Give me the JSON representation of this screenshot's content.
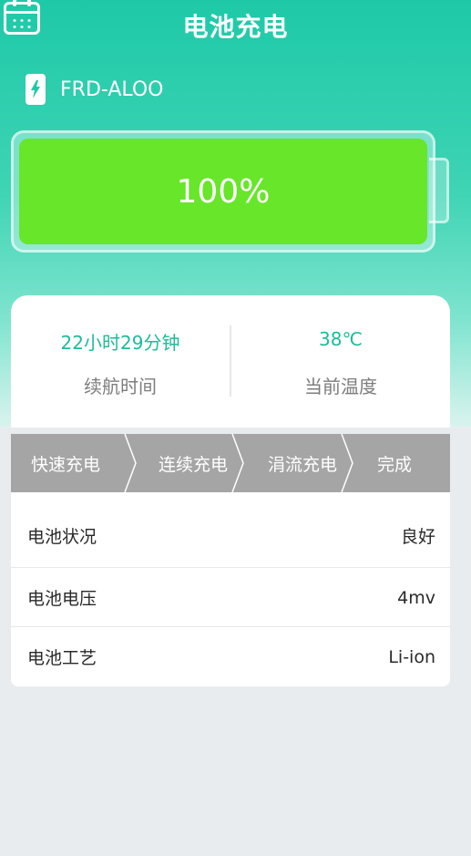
{
  "header": {
    "title": "电池充电"
  },
  "device": {
    "name": "FRD-ALOO"
  },
  "battery": {
    "level_percent": 100,
    "label": "100%",
    "fill_color": "#67e62a"
  },
  "stats": {
    "endurance": {
      "value": "22小时29分钟",
      "label": "续航时间"
    },
    "temperature": {
      "value": "38℃",
      "label": "当前温度"
    }
  },
  "charge_steps": [
    {
      "label": "快速充电"
    },
    {
      "label": "连续充电"
    },
    {
      "label": "涓流充电"
    },
    {
      "label": "完成"
    }
  ],
  "info": [
    {
      "label": "电池状况",
      "value": "良好"
    },
    {
      "label": "电池电压",
      "value": "4mv"
    },
    {
      "label": "电池工艺",
      "value": "Li-ion"
    }
  ],
  "icons": {
    "calendar": "calendar-icon",
    "phone": "phone-charging-icon"
  },
  "colors": {
    "accent": "#1ec9a8",
    "stat_text": "#1dbc9a",
    "battery_green": "#67e62a",
    "steps_bg": "#a5a5a5"
  }
}
